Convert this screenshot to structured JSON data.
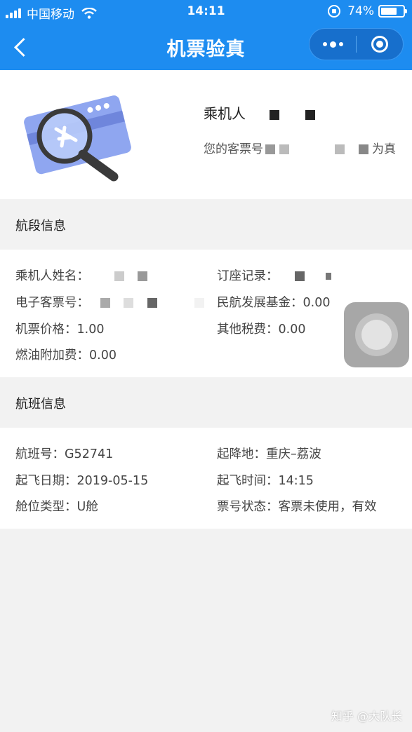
{
  "status_bar": {
    "carrier": "中国移动",
    "time": "14:11",
    "battery": "74%",
    "battery_level": 0.74
  },
  "navbar": {
    "title": "机票验真"
  },
  "summary": {
    "passenger_label": "乘机人",
    "ticket_prefix": "您的客票号",
    "ticket_suffix": "为真"
  },
  "segment": {
    "header": "航段信息",
    "rows": [
      {
        "label": "乘机人姓名：",
        "value": ""
      },
      {
        "label": "订座记录：",
        "value": ""
      },
      {
        "label": "电子客票号：",
        "value": ""
      },
      {
        "label": "民航发展基金：",
        "value": "0.00"
      },
      {
        "label": "机票价格：",
        "value": "1.00"
      },
      {
        "label": "其他税费：",
        "value": "0.00"
      },
      {
        "label": "燃油附加费：",
        "value": "0.00"
      }
    ]
  },
  "flight": {
    "header": "航班信息",
    "rows": [
      {
        "label": "航班号：",
        "value": "G52741"
      },
      {
        "label": "起降地：",
        "value": "重庆–荔波"
      },
      {
        "label": "起飞日期：",
        "value": "2019-05-15"
      },
      {
        "label": "起飞时间：",
        "value": "14:15"
      },
      {
        "label": "舱位类型：",
        "value": "U舱"
      },
      {
        "label": "票号状态：",
        "value": "客票未使用，有效"
      }
    ]
  },
  "watermark": "知乎 @大队长",
  "icons": [
    "signal-icon",
    "wifi-icon",
    "screen-lock-icon",
    "battery-icon",
    "back-icon",
    "more-icon",
    "close-capsule-icon",
    "ticket-magnifier-illustration",
    "floating-assistive-button"
  ],
  "colors": {
    "accent": "#1d8cf0",
    "background": "#f2f2f2"
  }
}
